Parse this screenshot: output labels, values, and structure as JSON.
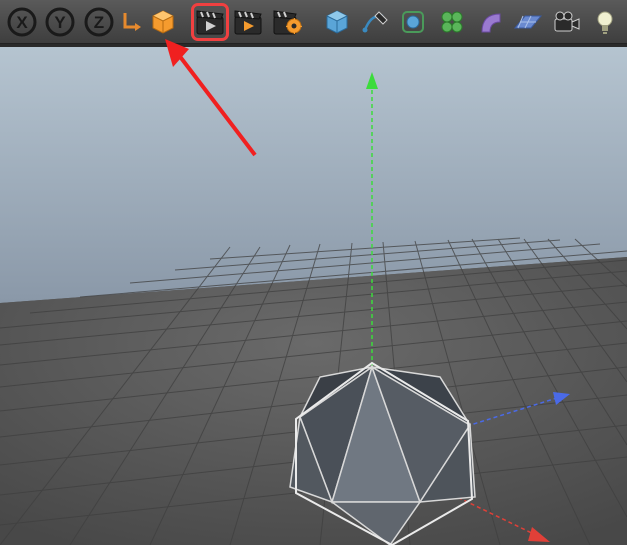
{
  "toolbar": {
    "buttons": [
      {
        "name": "x-axis-button",
        "label": "X"
      },
      {
        "name": "y-axis-button",
        "label": "Y"
      },
      {
        "name": "z-axis-button",
        "label": "Z"
      },
      {
        "name": "coord-system-button",
        "icon": "coord-system-icon"
      },
      {
        "name": "make-editable-button",
        "icon": "cube-orange-icon"
      },
      {
        "name": "render-view-button",
        "icon": "clapper-play-icon",
        "highlighted": true
      },
      {
        "name": "render-region-button",
        "icon": "clapper-play-orange-icon"
      },
      {
        "name": "render-settings-button",
        "icon": "clapper-gear-icon"
      },
      {
        "name": "primitive-cube-button",
        "icon": "primitive-cube-icon"
      },
      {
        "name": "spline-pen-button",
        "icon": "spline-pen-icon"
      },
      {
        "name": "subdivision-button",
        "icon": "subdivision-icon"
      },
      {
        "name": "array-button",
        "icon": "array-icon"
      },
      {
        "name": "bend-button",
        "icon": "bend-icon"
      },
      {
        "name": "floor-button",
        "icon": "floor-icon"
      },
      {
        "name": "camera-button",
        "icon": "camera-icon"
      },
      {
        "name": "light-button",
        "icon": "light-icon"
      }
    ]
  },
  "viewport": {
    "object": "icosahedron",
    "axes": [
      "x-red",
      "y-green",
      "z-blue"
    ],
    "grid": true
  },
  "annotation": {
    "type": "arrow",
    "color": "#f02020",
    "target": "render-view-button"
  }
}
